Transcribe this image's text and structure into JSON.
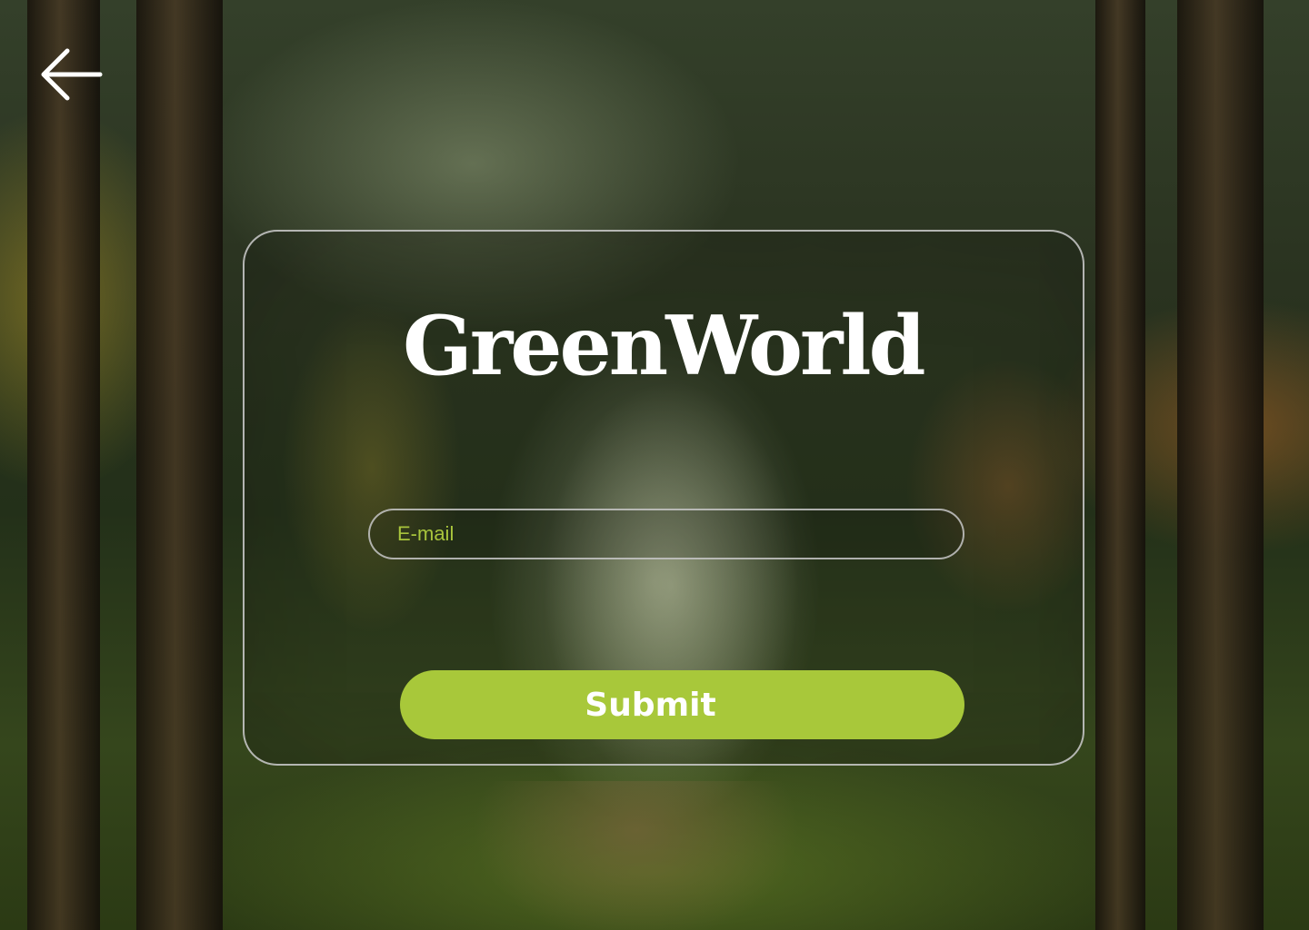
{
  "header": {
    "back_icon": "arrow-left-icon"
  },
  "card": {
    "brand": "GreenWorld",
    "email": {
      "placeholder": "E-mail",
      "value": ""
    },
    "submit_label": "Submit"
  },
  "colors": {
    "accent": "#a8c83a",
    "placeholder": "#a8c43c",
    "text": "#ffffff",
    "border": "#cdcdcd"
  }
}
